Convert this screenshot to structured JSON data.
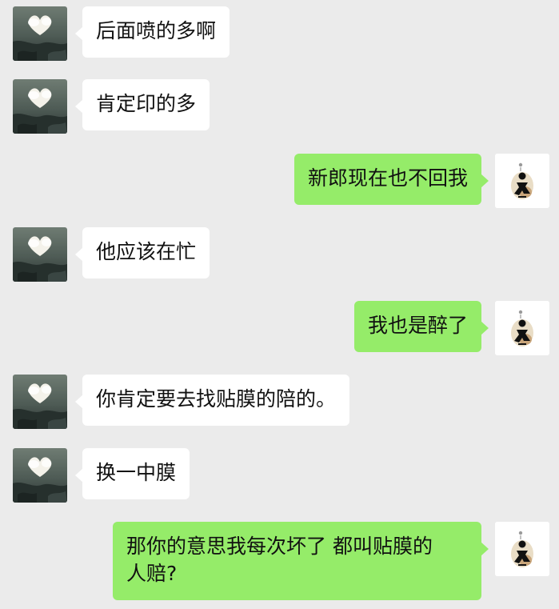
{
  "messages": [
    {
      "side": "in",
      "text": "后面喷的多啊"
    },
    {
      "side": "in",
      "text": "肯定印的多"
    },
    {
      "side": "out",
      "text": "新郎现在也不回我"
    },
    {
      "side": "in",
      "text": "他应该在忙"
    },
    {
      "side": "out",
      "text": "我也是醉了"
    },
    {
      "side": "in",
      "text": "你肯定要去找贴膜的陪的。"
    },
    {
      "side": "in",
      "text": "换一中膜"
    },
    {
      "side": "out",
      "lines": [
        "那你的意思我每次坏了 都叫贴膜的",
        "人赔?"
      ]
    }
  ],
  "colors": {
    "background": "#ebebeb",
    "incoming_bubble": "#ffffff",
    "outgoing_bubble": "#95ec69"
  },
  "icons": {
    "incoming_avatar": "cloud-heart-avatar",
    "outgoing_avatar": "figure-sticker-avatar"
  }
}
